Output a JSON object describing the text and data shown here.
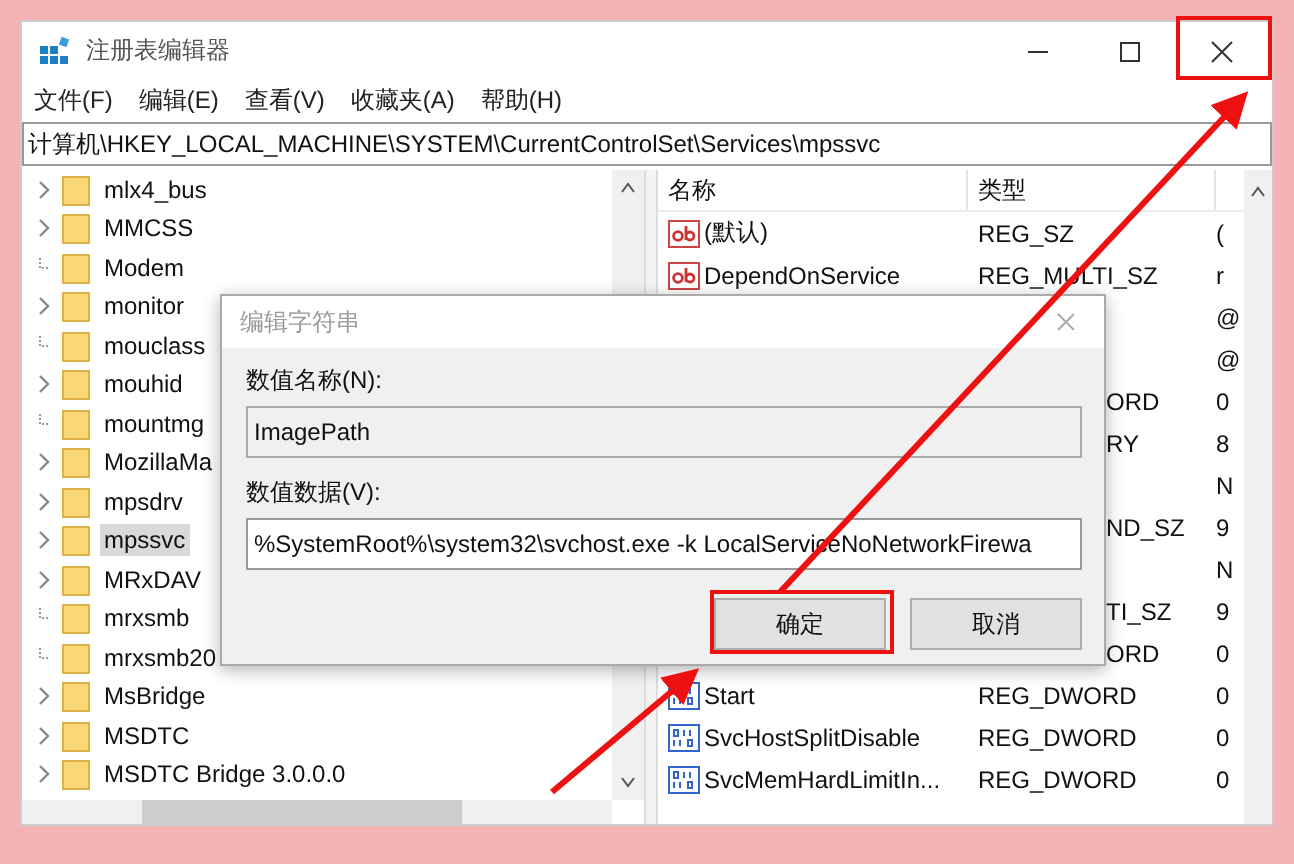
{
  "window": {
    "title": "注册表编辑器"
  },
  "menu": [
    "文件(F)",
    "编辑(E)",
    "查看(V)",
    "收藏夹(A)",
    "帮助(H)"
  ],
  "address": "计算机\\HKEY_LOCAL_MACHINE\\SYSTEM\\CurrentControlSet\\Services\\mpssvc",
  "tree": [
    {
      "label": "mlx4_bus",
      "expandable": true,
      "selected": false
    },
    {
      "label": "MMCSS",
      "expandable": true,
      "selected": false
    },
    {
      "label": "Modem",
      "expandable": false,
      "selected": false
    },
    {
      "label": "monitor",
      "expandable": true,
      "selected": false
    },
    {
      "label": "mouclass",
      "expandable": false,
      "selected": false
    },
    {
      "label": "mouhid",
      "expandable": true,
      "selected": false
    },
    {
      "label": "mountmg",
      "expandable": false,
      "selected": false
    },
    {
      "label": "MozillaMa",
      "expandable": true,
      "selected": false
    },
    {
      "label": "mpsdrv",
      "expandable": true,
      "selected": false
    },
    {
      "label": "mpssvc",
      "expandable": true,
      "selected": true
    },
    {
      "label": "MRxDAV",
      "expandable": true,
      "selected": false
    },
    {
      "label": "mrxsmb",
      "expandable": false,
      "selected": false
    },
    {
      "label": "mrxsmb20",
      "expandable": false,
      "selected": false
    },
    {
      "label": "MsBridge",
      "expandable": true,
      "selected": false
    },
    {
      "label": "MSDTC",
      "expandable": true,
      "selected": false
    },
    {
      "label": "MSDTC Bridge 3.0.0.0",
      "expandable": true,
      "selected": false
    }
  ],
  "values": {
    "columns": [
      "名称",
      "类型"
    ],
    "rows": [
      {
        "kind": "string",
        "name": "(默认)",
        "type": "REG_SZ",
        "column_3": "("
      },
      {
        "kind": "string",
        "name": "DependOnService",
        "type": "REG_MULTI_SZ",
        "column_3": "r"
      },
      {
        "kind": "covered",
        "type": "",
        "column_3": "@"
      },
      {
        "kind": "covered",
        "type": "",
        "column_3": "@"
      },
      {
        "kind": "covered",
        "type": "ORD",
        "column_3": "0"
      },
      {
        "kind": "covered",
        "type": "RY",
        "column_3": "8"
      },
      {
        "kind": "covered",
        "type": "",
        "column_3": "N"
      },
      {
        "kind": "covered",
        "type": "ND_SZ",
        "column_3": "9"
      },
      {
        "kind": "covered",
        "type": "",
        "column_3": "N"
      },
      {
        "kind": "covered",
        "type": "TI_SZ",
        "column_3": "9"
      },
      {
        "kind": "covered",
        "type": "ORD",
        "column_3": "0"
      },
      {
        "kind": "number",
        "name": "Start",
        "type": "REG_DWORD",
        "column_3": "0"
      },
      {
        "kind": "number",
        "name": "SvcHostSplitDisable",
        "type": "REG_DWORD",
        "column_3": "0"
      },
      {
        "kind": "number",
        "name": "SvcMemHardLimitIn...",
        "type": "REG_DWORD",
        "column_3": "0"
      }
    ]
  },
  "dialog": {
    "title": "编辑字符串",
    "name_label": "数值名称(N):",
    "name_value": "ImagePath",
    "data_label": "数值数据(V):",
    "data_value": "%SystemRoot%\\system32\\svchost.exe -k LocalServiceNoNetworkFirewa",
    "buttons": [
      "确定",
      "取消"
    ]
  }
}
